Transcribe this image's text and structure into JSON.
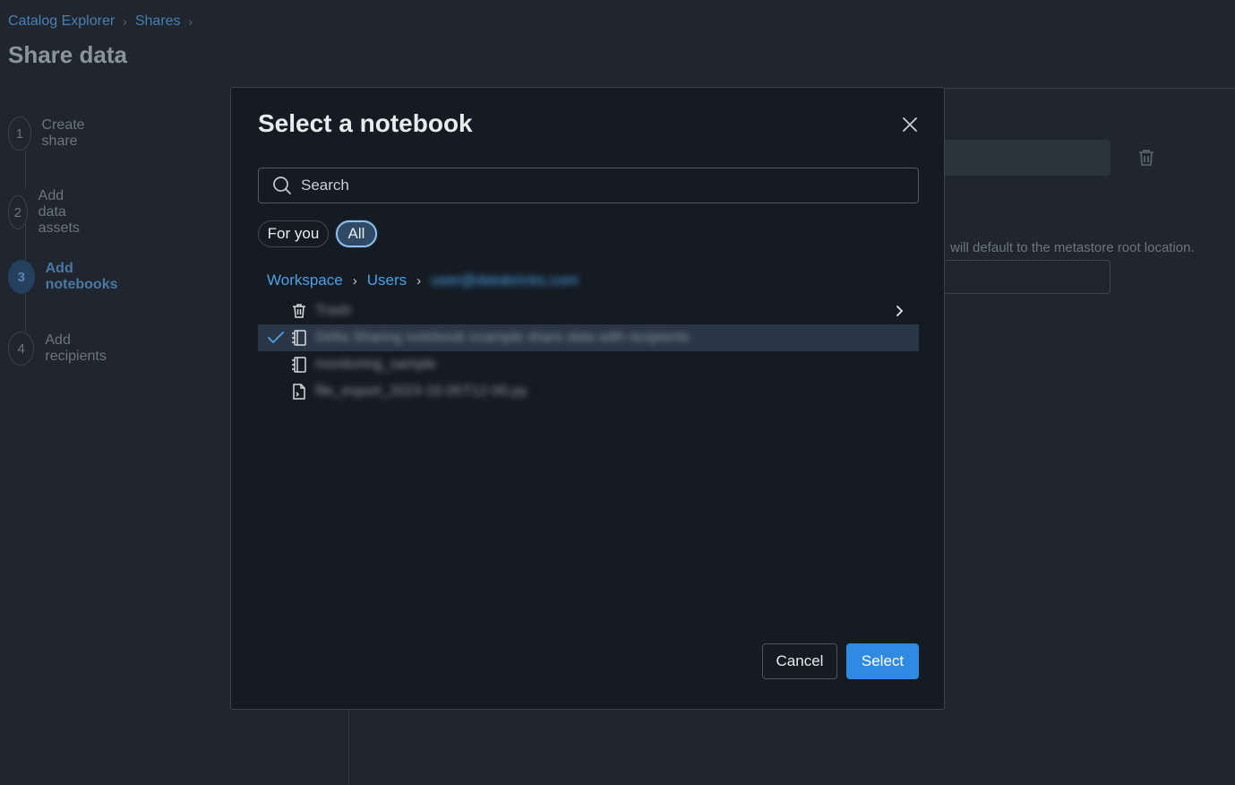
{
  "breadcrumb": {
    "items": [
      "Catalog Explorer",
      "Shares"
    ]
  },
  "page": {
    "title": "Share data"
  },
  "steps": [
    {
      "num": "1",
      "label": "Create share"
    },
    {
      "num": "2",
      "label": "Add data assets"
    },
    {
      "num": "3",
      "label": "Add notebooks",
      "active": true
    },
    {
      "num": "4",
      "label": "Add recipients"
    }
  ],
  "background": {
    "hint": "will default to the metastore root location."
  },
  "modal": {
    "title": "Select a notebook",
    "search": {
      "placeholder": "Search",
      "value": ""
    },
    "filters": {
      "for_you": "For you",
      "all": "All",
      "selected": "All"
    },
    "path": {
      "workspace": "Workspace",
      "users": "Users",
      "user_folder": "user@databricks.com"
    },
    "items": [
      {
        "icon": "trash-icon",
        "name": "Trash",
        "has_children": true,
        "selected": false
      },
      {
        "icon": "notebook-icon",
        "name": "Delta Sharing notebook example share data with recipients",
        "selected": true
      },
      {
        "icon": "notebook-icon",
        "name": "monitoring_sample",
        "selected": false
      },
      {
        "icon": "file-code-icon",
        "name": "file_export_2023-10-05T12-00.py",
        "selected": false
      }
    ],
    "buttons": {
      "cancel": "Cancel",
      "select": "Select"
    }
  },
  "colors": {
    "accent": "#2f8ae2",
    "link": "#4ba1e6",
    "modal_bg": "#151b23",
    "page_bg": "#1f262f"
  }
}
